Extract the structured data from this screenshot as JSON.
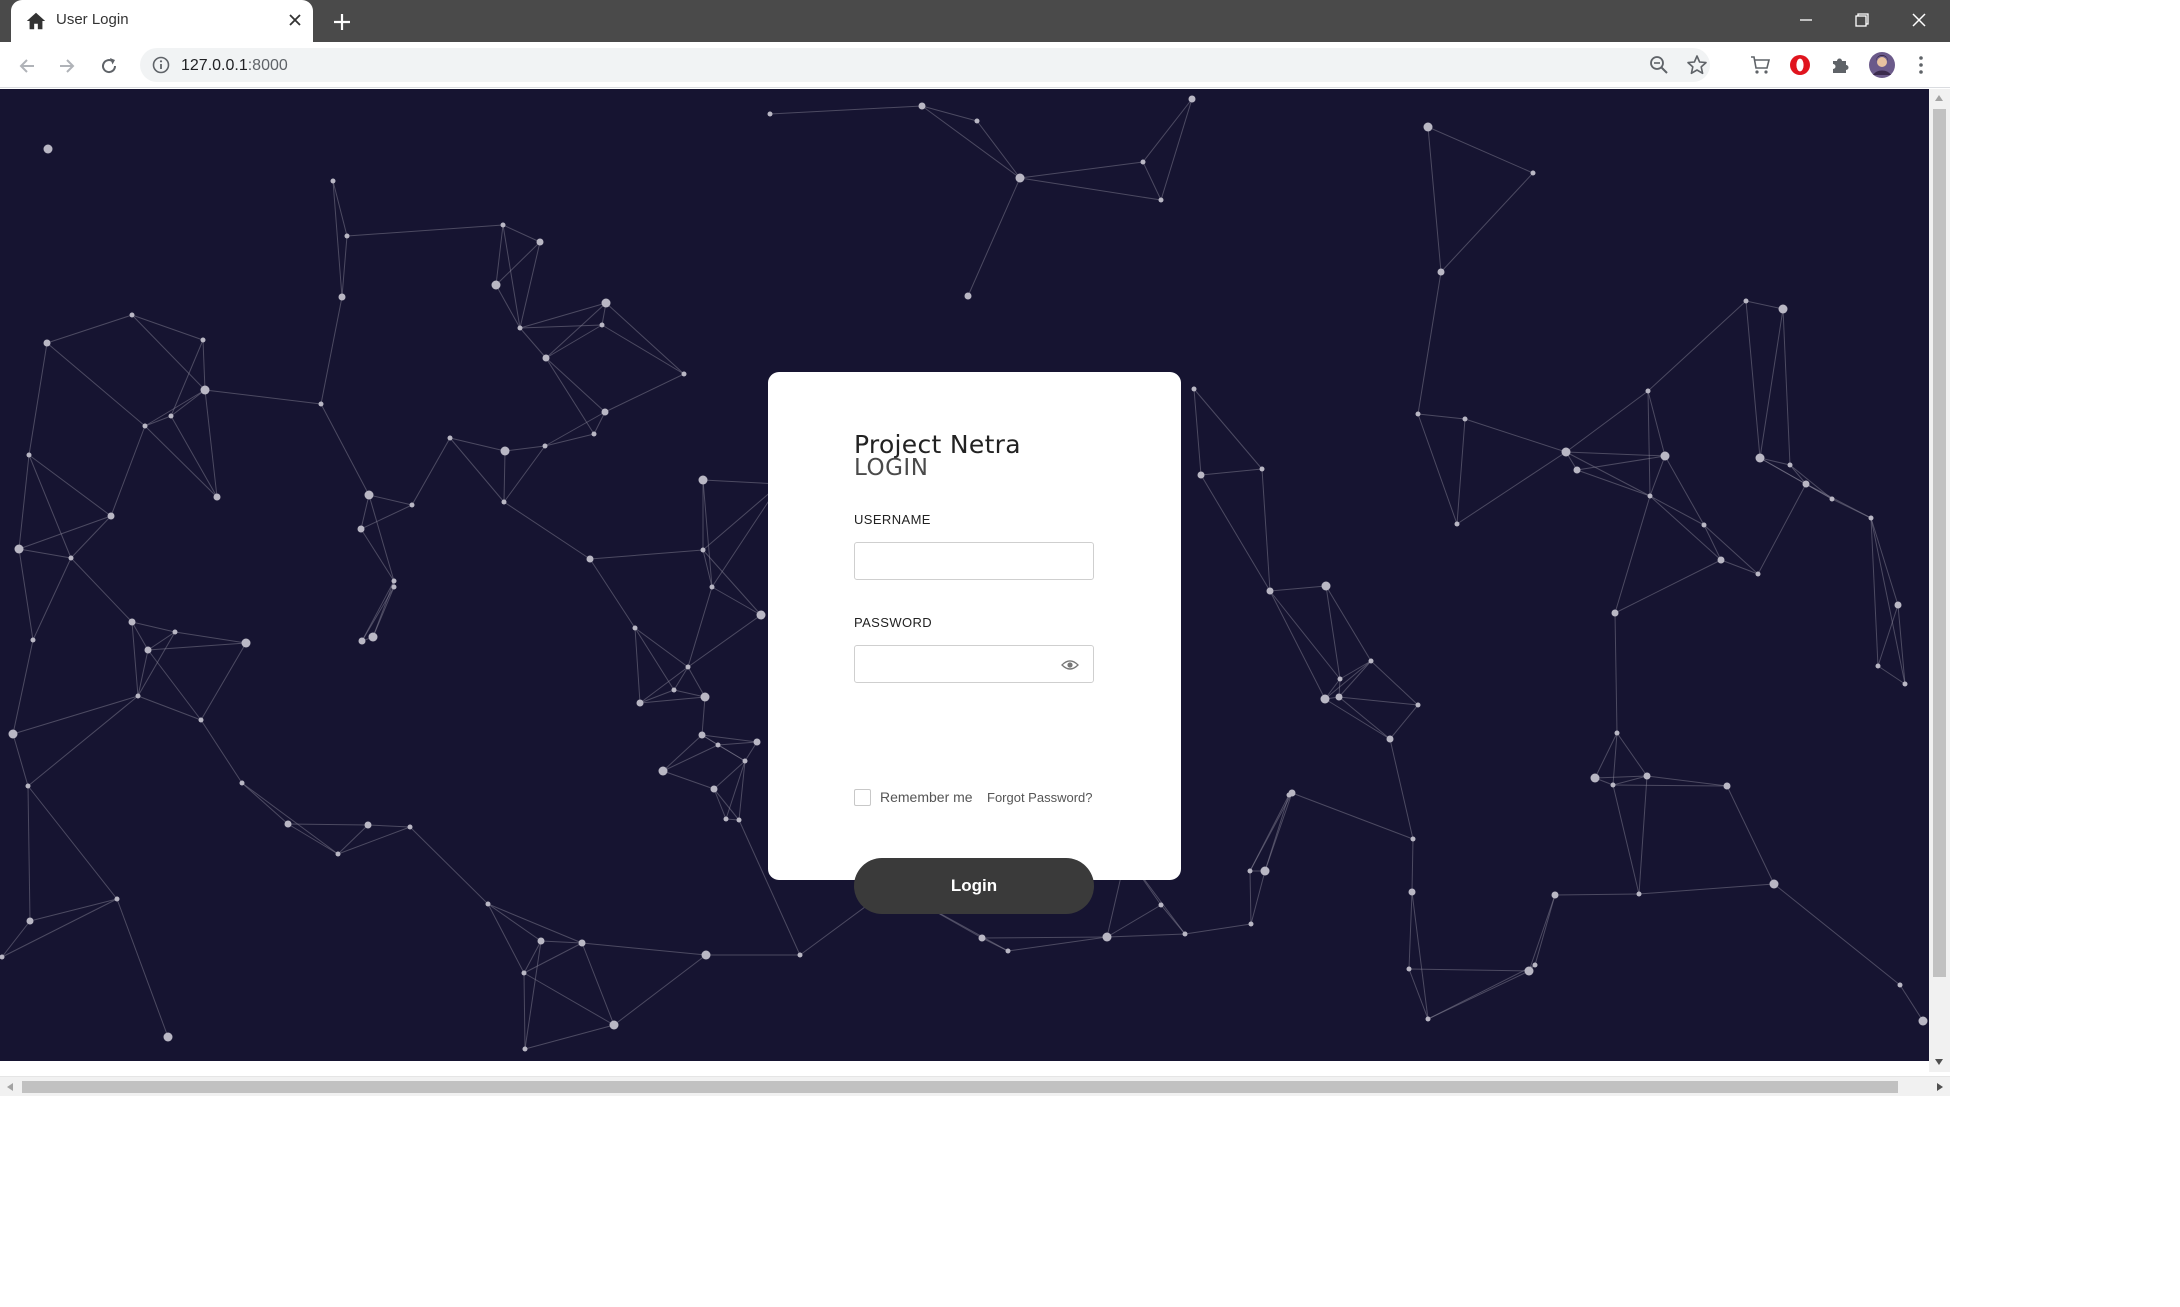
{
  "browser": {
    "tab_title": "User Login",
    "url_host": "127.0.0.1",
    "url_port": ":8000"
  },
  "icons": {
    "tab_favicon": "home-icon",
    "tab_close": "close-icon",
    "new_tab": "plus-icon",
    "back": "arrow-left-icon",
    "forward": "arrow-right-icon",
    "reload": "reload-icon",
    "site_info": "info-icon",
    "zoom": "zoom-icon",
    "bookmark": "star-icon",
    "extensions": [
      "cart-icon",
      "opera-icon",
      "puzzle-icon"
    ],
    "profile": "avatar-icon",
    "menu": "kebab-menu-icon",
    "password_toggle": "eye-icon"
  },
  "colors": {
    "page_background": "#161431",
    "network_lines": "#8d8b9e",
    "network_nodes": "#b9b7c4",
    "button_dark": "#3a3a3a",
    "card_background": "#ffffff"
  },
  "login": {
    "app_name": "Project Netra",
    "heading": "LOGIN",
    "username_label": "USERNAME",
    "username_value": "",
    "password_label": "PASSWORD",
    "password_value": "",
    "remember_label": "Remember me",
    "remember_checked": false,
    "forgot_label": "Forgot Password?",
    "submit_label": "Login"
  }
}
